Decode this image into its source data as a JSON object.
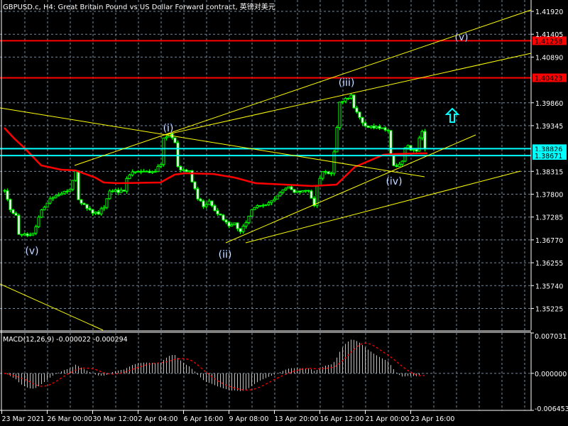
{
  "header": {
    "title": "GBPUSD.c, H4:  Great Britain Pound vs US Dollar Forward contract, 英镑对美元"
  },
  "chart_data": {
    "type": "candlestick",
    "symbol": "GBPUSD.c",
    "timeframe": "H4",
    "title": "GBPUSD.c, H4:  Great Britain Pound vs US Dollar Forward contract, 英镑对美元",
    "ylim": [
      1.34736,
      1.42176
    ],
    "price_ticks": [
      "1.41920",
      "1.41405",
      "1.40890",
      "1.39860",
      "1.39345",
      "1.38315",
      "1.37800",
      "1.37285",
      "1.36770",
      "1.36255",
      "1.35740",
      "1.35225"
    ],
    "time_labels": [
      "23 Mar 2021",
      "26 Mar 00:00",
      "30 Mar 12:00",
      "2 Apr 04:00",
      "6 Apr 16:00",
      "9 Apr 08:00",
      "13 Apr 20:00",
      "16 Apr 12:00",
      "21 Apr 00:00",
      "23 Apr 16:00"
    ],
    "bar_count": 149,
    "close_path": [
      [
        0,
        1.37856
      ],
      [
        2,
        1.37456
      ],
      [
        4,
        1.37296
      ],
      [
        5,
        1.36896
      ],
      [
        7,
        1.36896
      ],
      [
        10,
        1.36896
      ],
      [
        11,
        1.37056
      ],
      [
        13,
        1.37456
      ],
      [
        16,
        1.37696
      ],
      [
        18,
        1.37776
      ],
      [
        21,
        1.37856
      ],
      [
        23,
        1.37936
      ],
      [
        25,
        1.38336
      ],
      [
        26,
        1.37696
      ],
      [
        28,
        1.37536
      ],
      [
        31,
        1.37376
      ],
      [
        33,
        1.37376
      ],
      [
        35,
        1.37536
      ],
      [
        37,
        1.37888
      ],
      [
        40,
        1.37856
      ],
      [
        42,
        1.37888
      ],
      [
        43,
        1.38176
      ],
      [
        46,
        1.38336
      ],
      [
        48,
        1.38336
      ],
      [
        51,
        1.38288
      ],
      [
        53,
        1.38336
      ],
      [
        55,
        1.38496
      ],
      [
        56,
        1.39056
      ],
      [
        58,
        1.39136
      ],
      [
        60,
        1.38976
      ],
      [
        61,
        1.38416
      ],
      [
        63,
        1.38336
      ],
      [
        65,
        1.38336
      ],
      [
        66,
        1.38096
      ],
      [
        68,
        1.37696
      ],
      [
        70,
        1.37536
      ],
      [
        72,
        1.37616
      ],
      [
        75,
        1.37376
      ],
      [
        77,
        1.37216
      ],
      [
        79,
        1.37056
      ],
      [
        81,
        1.37136
      ],
      [
        83,
        1.36976
      ],
      [
        85,
        1.37136
      ],
      [
        87,
        1.37456
      ],
      [
        90,
        1.37536
      ],
      [
        92,
        1.37536
      ],
      [
        95,
        1.37696
      ],
      [
        97,
        1.37856
      ],
      [
        100,
        1.37936
      ],
      [
        102,
        1.37856
      ],
      [
        105,
        1.37856
      ],
      [
        107,
        1.37856
      ],
      [
        109,
        1.37536
      ],
      [
        110,
        1.38016
      ],
      [
        112,
        1.38336
      ],
      [
        115,
        1.38256
      ],
      [
        116,
        1.38736
      ],
      [
        117,
        1.39296
      ],
      [
        118,
        1.39856
      ],
      [
        120,
        1.39936
      ],
      [
        122,
        1.40016
      ],
      [
        123,
        1.39776
      ],
      [
        125,
        1.39536
      ],
      [
        126,
        1.39376
      ],
      [
        128,
        1.39328
      ],
      [
        131,
        1.39296
      ],
      [
        133,
        1.39328
      ],
      [
        135,
        1.39216
      ],
      [
        136,
        1.38656
      ],
      [
        137,
        1.38416
      ],
      [
        139,
        1.38496
      ],
      [
        140,
        1.38576
      ],
      [
        141,
        1.38816
      ],
      [
        142,
        1.38896
      ],
      [
        143,
        1.38816
      ],
      [
        145,
        1.38736
      ],
      [
        146,
        1.39056
      ],
      [
        147,
        1.39216
      ],
      [
        148,
        1.38816
      ]
    ],
    "moving_average": [
      [
        0,
        1.39296
      ],
      [
        3.5,
        1.39056
      ],
      [
        7,
        1.38848
      ],
      [
        13,
        1.38448
      ],
      [
        20,
        1.38352
      ],
      [
        25,
        1.38336
      ],
      [
        32,
        1.38176
      ],
      [
        35,
        1.38064
      ],
      [
        40,
        1.38048
      ],
      [
        55,
        1.38064
      ],
      [
        60,
        1.3824
      ],
      [
        63.5,
        1.38272
      ],
      [
        73.5,
        1.38256
      ],
      [
        81,
        1.38176
      ],
      [
        88.5,
        1.38048
      ],
      [
        108.5,
        1.37984
      ],
      [
        117,
        1.38016
      ],
      [
        123.5,
        1.38416
      ],
      [
        133.5,
        1.38688
      ],
      [
        137,
        1.38704
      ],
      [
        146,
        1.3872
      ],
      [
        149,
        1.3872
      ]
    ],
    "horizontal_lines": [
      {
        "price": 1.41258,
        "label": "1.41258",
        "color": "#ff0000",
        "text_color": "#000000"
      },
      {
        "price": 1.40423,
        "label": "1.40423",
        "color": "#ff0000",
        "text_color": "#000000"
      },
      {
        "price": 1.38826,
        "label": "1.38826",
        "color": "#00ffff",
        "text_color": "#000000"
      },
      {
        "price": 1.38671,
        "label": "1.38671",
        "color": "#00ffff",
        "text_color": "#000000"
      }
    ],
    "trendlines": [
      [
        [
          24.75,
          1.38448
        ],
        [
          185.5,
          1.41952
        ]
      ],
      [
        [
          56.5,
          1.39136
        ],
        [
          185.5,
          1.40976
        ]
      ],
      [
        [
          -1.5,
          1.39744
        ],
        [
          148,
          1.38192
        ]
      ],
      [
        [
          78,
          1.36704
        ],
        [
          166,
          1.39136
        ]
      ],
      [
        [
          85,
          1.36704
        ],
        [
          181.75,
          1.3832
        ]
      ],
      [
        [
          -1.5,
          1.35776
        ],
        [
          34.75,
          1.34736
        ]
      ]
    ],
    "wave_labels": [
      {
        "text": "(v)",
        "idx": 9.75,
        "price": 1.36528
      },
      {
        "text": "(i)",
        "idx": 57.75,
        "price": 1.39296
      },
      {
        "text": "(ii)",
        "idx": 77.75,
        "price": 1.36448
      },
      {
        "text": "(iii)",
        "idx": 120.5,
        "price": 1.4032
      },
      {
        "text": "(iv)",
        "idx": 137.25,
        "price": 1.38096
      },
      {
        "text": "(v)",
        "idx": 161,
        "price": 1.41344
      }
    ],
    "arrow": {
      "direction": "up",
      "idx": 157.75,
      "price": 1.39568,
      "color": "#00ffff"
    },
    "colors": {
      "candle": "#00ff00",
      "bull_body": "#000000",
      "bear_body": "#ffffff",
      "ma": "#ff0000",
      "trendline": "#ffff00",
      "grid": "#778899"
    },
    "macd": {
      "label": "MACD(12,26,9) -0.000022 -0.000294",
      "fast": 12,
      "slow": 26,
      "signal": 9,
      "main_value": -2.2e-05,
      "signal_value": -0.000294,
      "ylim": [
        -0.006453,
        0.007031
      ],
      "ticks": [
        "0.007031",
        "0.000000",
        "-0.006453"
      ],
      "histogram_color": "#c0c0c0",
      "signal_color": "#ff0000"
    }
  }
}
